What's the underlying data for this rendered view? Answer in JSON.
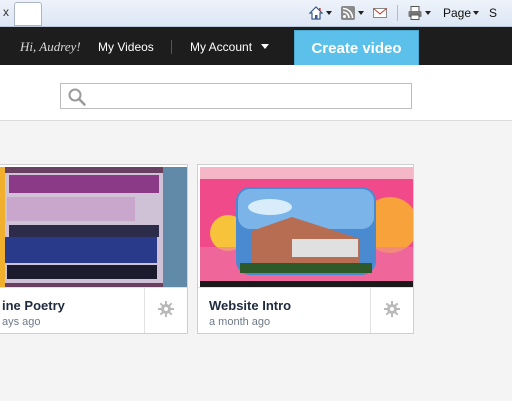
{
  "browser": {
    "tab_close_glyph": "x",
    "page_menu_label": "Page",
    "safety_menu_label_partial": "S",
    "icons": [
      "home-icon",
      "rss-feed-icon",
      "read-mail-icon",
      "print-icon"
    ]
  },
  "nav": {
    "greeting": "Hi, Audrey!",
    "my_videos": "My Videos",
    "my_account": "My Account",
    "create_video": "Create video"
  },
  "search": {
    "placeholder": "",
    "value": ""
  },
  "videos": [
    {
      "title": "ine Poetry",
      "subtitle": "ays ago"
    },
    {
      "title": "Website Intro",
      "subtitle": "a month ago"
    }
  ],
  "colors": {
    "nav_bg": "#1d1d1d",
    "create_button": "#5bc0ea",
    "page_bg": "#f4f4f4",
    "card_title": "#1e2a3e"
  }
}
